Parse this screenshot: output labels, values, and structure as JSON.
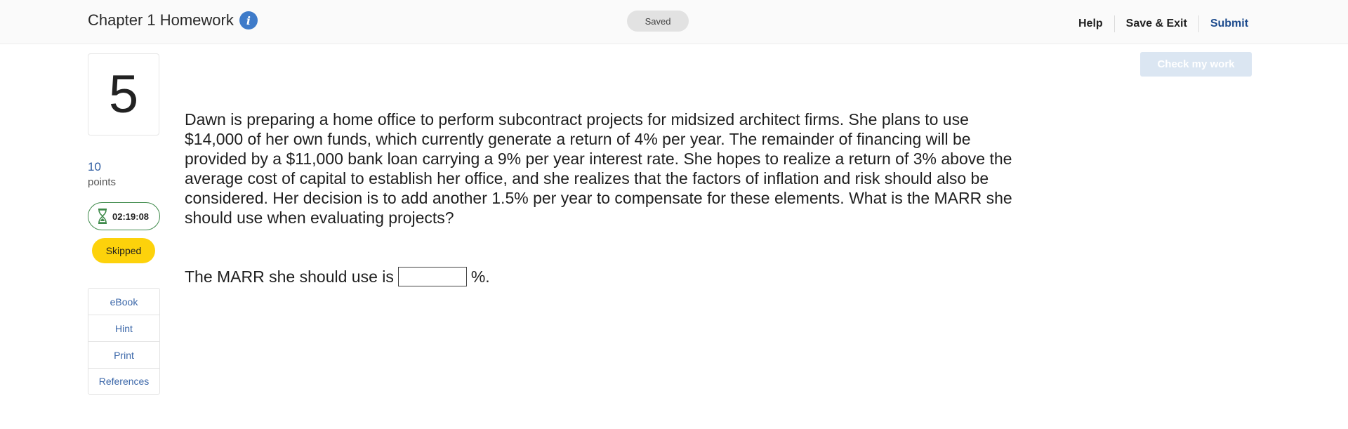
{
  "header": {
    "title": "Chapter 1 Homework",
    "info_icon": "info-circle-icon",
    "status_badge": "Saved",
    "nav": {
      "help": "Help",
      "save_exit": "Save & Exit",
      "submit": "Submit"
    }
  },
  "toolbar": {
    "check_my_work": "Check my work"
  },
  "sidebar": {
    "question_number": "5",
    "points_value": "10",
    "points_label": "points",
    "timer_icon": "hourglass-icon",
    "timer": "02:19:08",
    "status": "Skipped",
    "tools": [
      {
        "label": "eBook"
      },
      {
        "label": "Hint"
      },
      {
        "label": "Print"
      },
      {
        "label": "References"
      }
    ]
  },
  "question": {
    "text": "Dawn is preparing a home office to perform subcontract projects for midsized architect firms. She plans to use $14,000 of her own funds, which currently generate a return of 4% per year. The remainder of financing will be provided by a $11,000 bank loan carrying a 9% per year interest rate. She hopes to realize a return of 3% above the average cost of capital to establish her office, and she realizes that the factors of inflation and risk should also be considered. Her decision is to add another 1.5% per year to compensate for these elements. What is the MARR she should use when evaluating projects?",
    "answer_prefix": "The MARR she should use is",
    "answer_value": "",
    "answer_suffix": "%."
  },
  "colors": {
    "accent_blue": "#3e7bc9",
    "link_blue": "#3a66a8",
    "submit_blue": "#1c4a8c",
    "timer_green": "#3f8a4b",
    "skipped_yellow": "#fdd20b",
    "check_btn_disabled": "#dbe6f2"
  }
}
